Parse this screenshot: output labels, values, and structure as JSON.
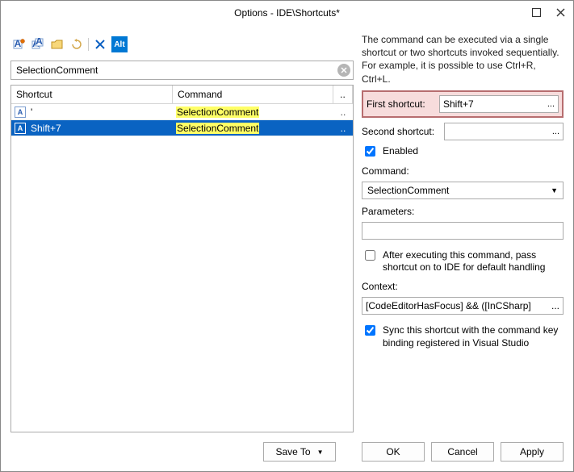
{
  "window": {
    "title": "Options - IDE\\Shortcuts*"
  },
  "search": {
    "value": "SelectionComment"
  },
  "columns": {
    "shortcut": "Shortcut",
    "command": "Command",
    "more": ".."
  },
  "rows": [
    {
      "shortcut": "'",
      "command": "SelectionComment",
      "selected": false
    },
    {
      "shortcut": "Shift+7",
      "command": "SelectionComment",
      "selected": true
    }
  ],
  "rightDesc": "The command can be executed via a single shortcut or two shortcuts invoked sequentially. For example, it is possible to use Ctrl+R, Ctrl+L.",
  "labels": {
    "firstShortcut": "First shortcut:",
    "secondShortcut": "Second shortcut:",
    "enabled": "Enabled",
    "command": "Command:",
    "parameters": "Parameters:",
    "passThrough": "After executing this command, pass shortcut on to IDE for default handling",
    "context": "Context:",
    "sync": "Sync this shortcut with the command key binding registered in Visual Studio"
  },
  "values": {
    "firstShortcut": "Shift+7",
    "secondShortcut": "",
    "enabled": true,
    "command": "SelectionComment",
    "parameters": "",
    "passThrough": false,
    "context": "[CodeEditorHasFocus] && ([InCSharp]",
    "sync": true
  },
  "buttons": {
    "saveTo": "Save To",
    "ok": "OK",
    "cancel": "Cancel",
    "apply": "Apply"
  },
  "dots": "...",
  "altLabel": "Alt"
}
